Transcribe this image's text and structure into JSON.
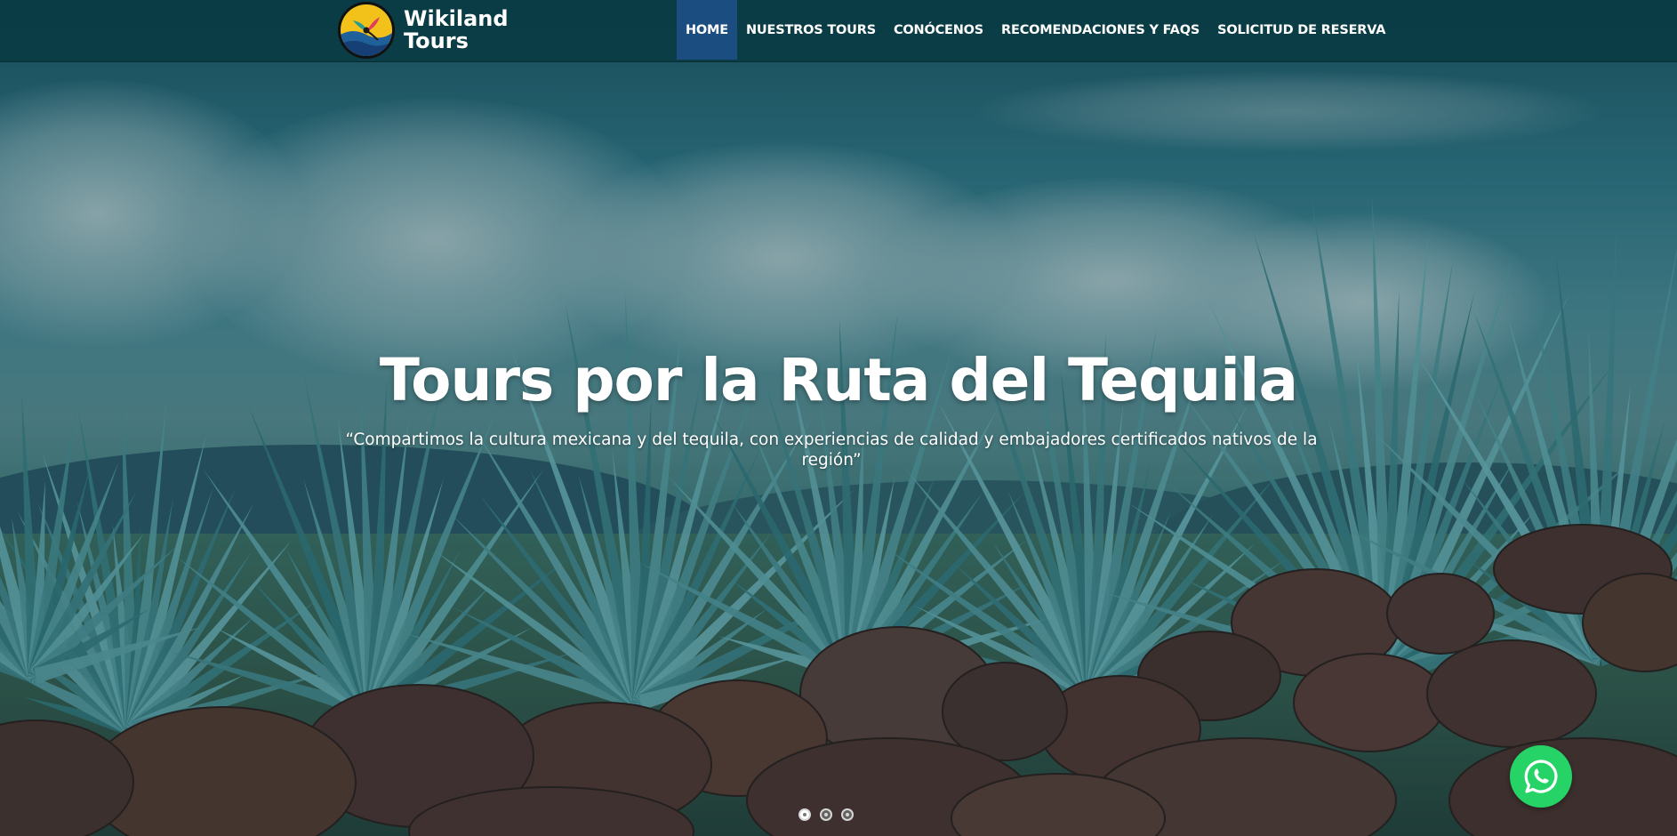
{
  "brand": {
    "line1": "Wikiland",
    "line2": "Tours",
    "logo_icon": "hummingbird-logo-icon"
  },
  "nav": {
    "items": [
      {
        "label": "HOME",
        "active": true
      },
      {
        "label": "NUESTROS TOURS",
        "active": false
      },
      {
        "label": "CONÓCENOS",
        "active": false
      },
      {
        "label": "RECOMENDACIONES Y FAQS",
        "active": false
      },
      {
        "label": "SOLICITUD DE RESERVA",
        "active": false
      }
    ],
    "active_color": "#1c4d80",
    "bar_color": "#083a42"
  },
  "hero": {
    "title": "Tours por la Ruta del Tequila",
    "quote": "“Compartimos la cultura mexicana y del tequila, con experiencias de calidad y embajadores certificados nativos de la región”"
  },
  "carousel": {
    "slide_count": 3,
    "active_index": 0
  },
  "whatsapp": {
    "icon": "whatsapp-icon",
    "color": "#25d366"
  }
}
